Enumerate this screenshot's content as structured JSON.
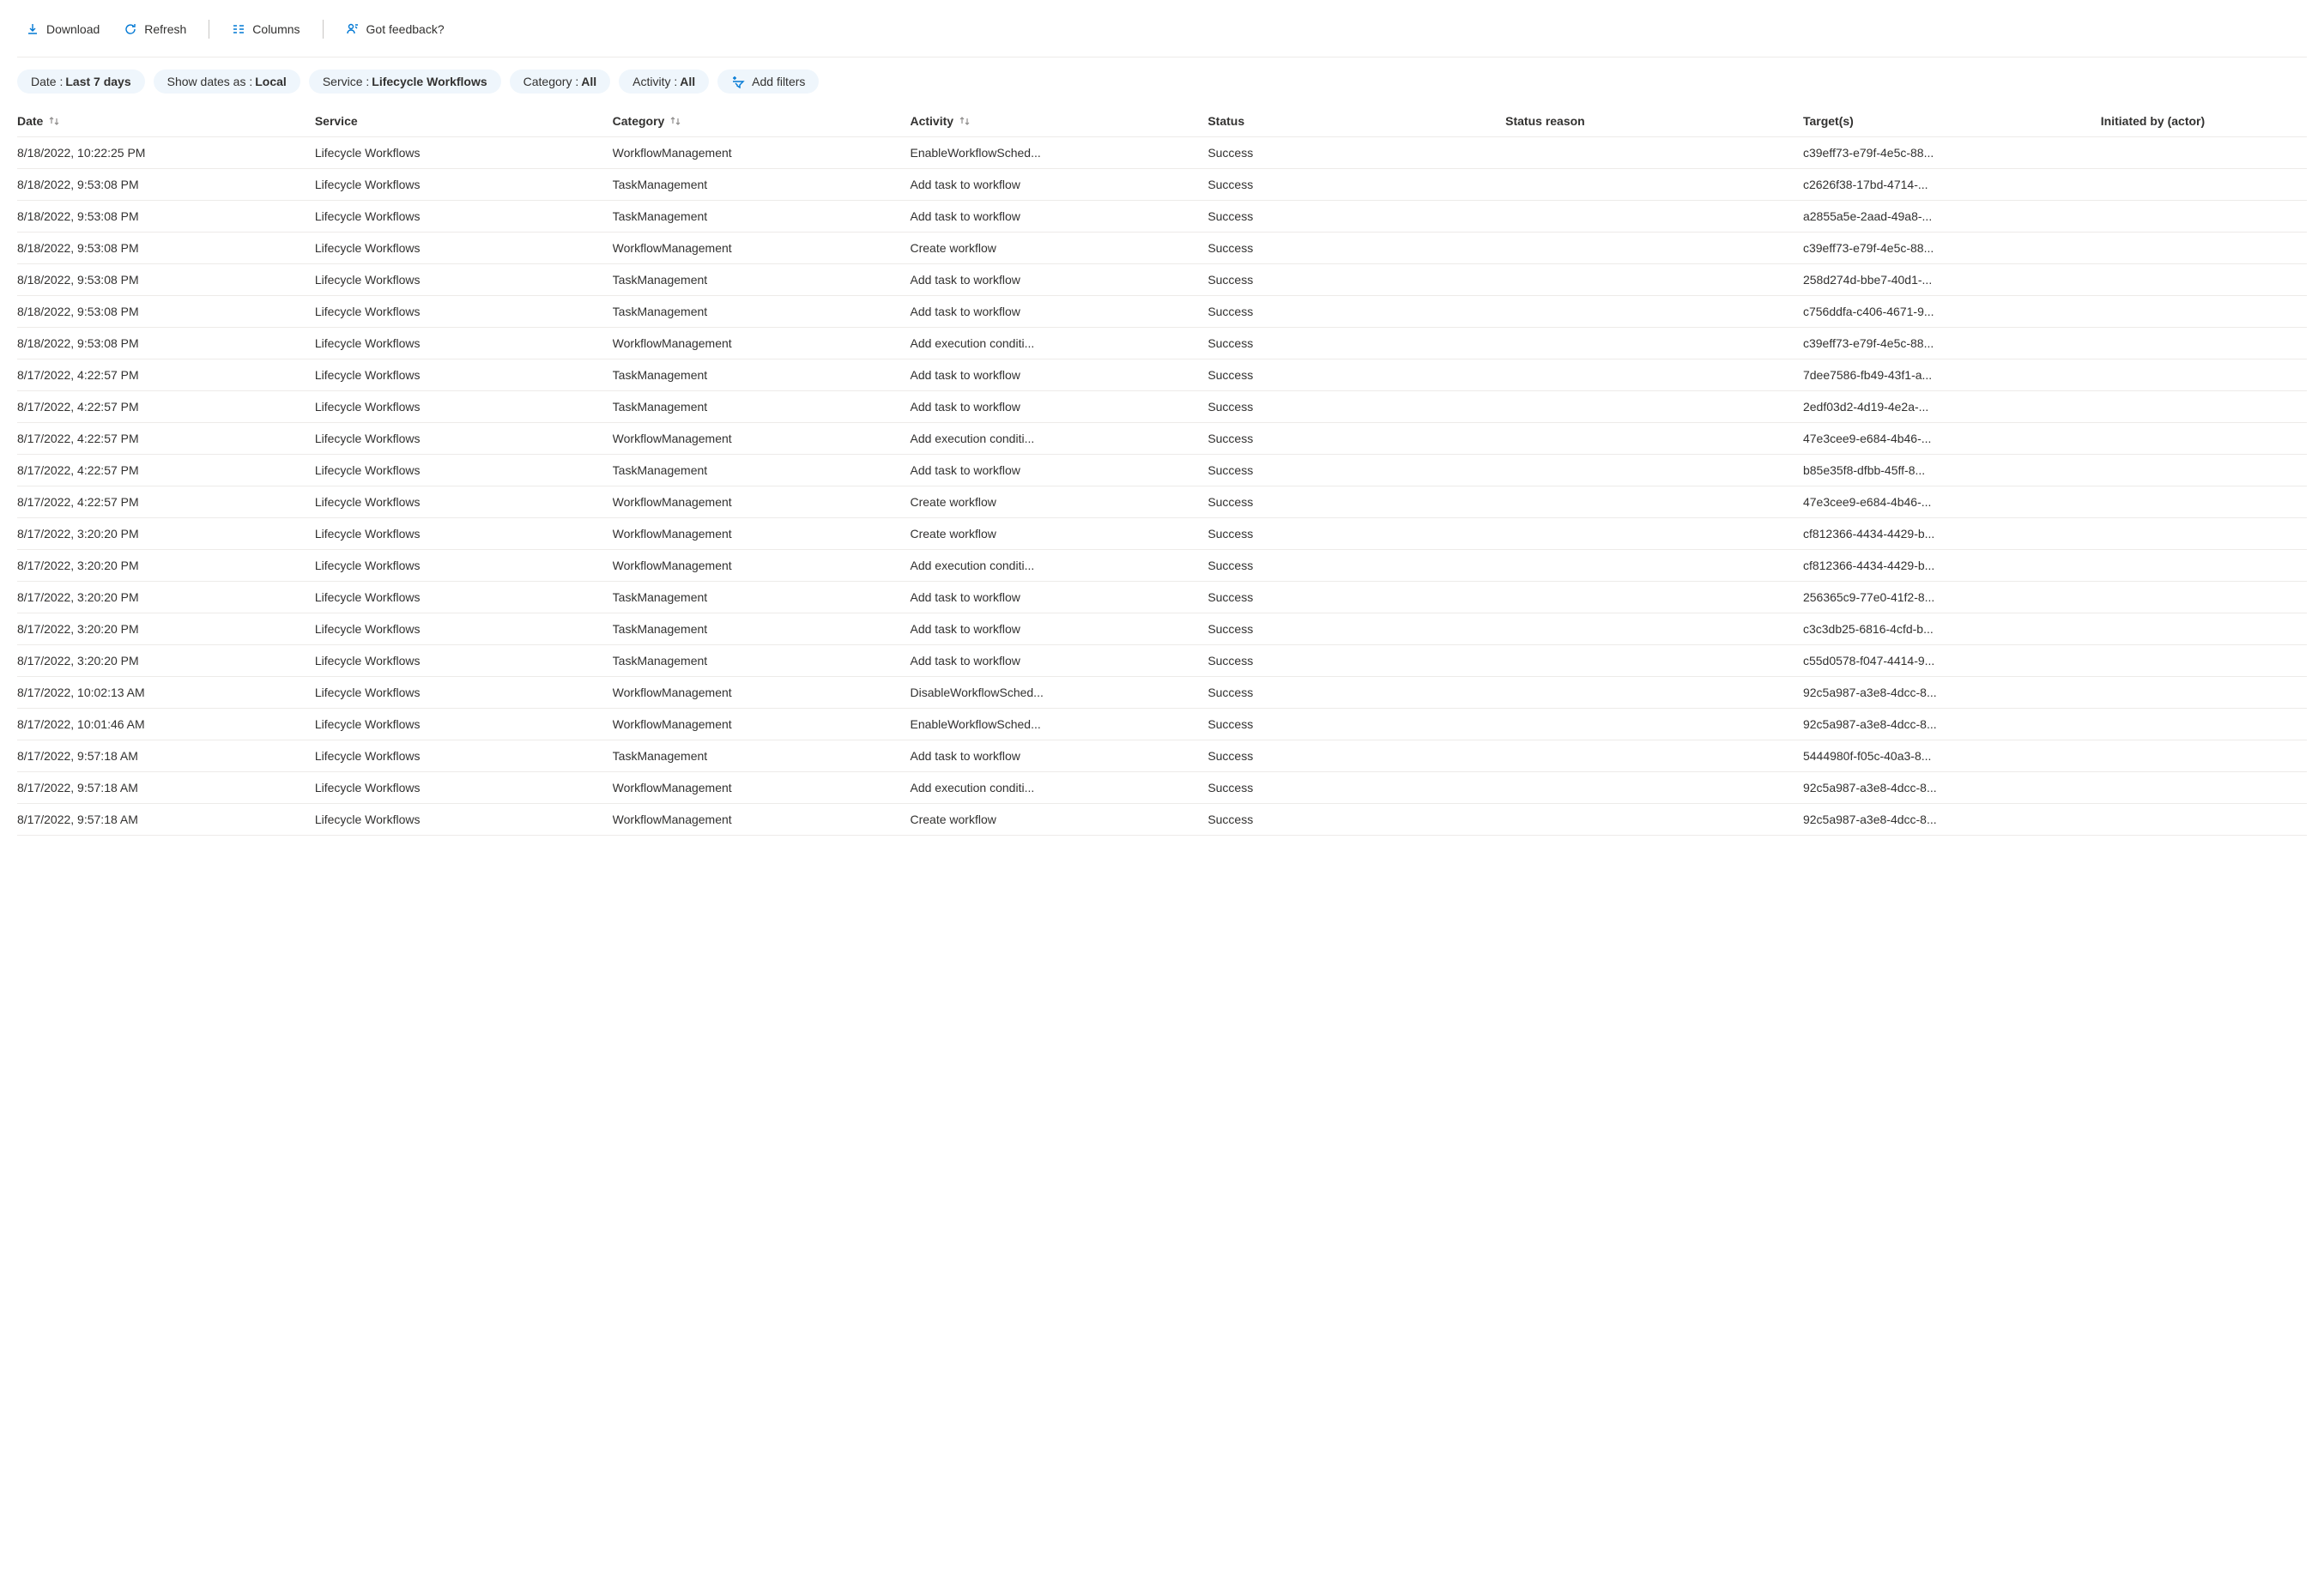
{
  "toolbar": {
    "download": "Download",
    "refresh": "Refresh",
    "columns": "Columns",
    "feedback": "Got feedback?"
  },
  "filters": {
    "date": {
      "label": "Date : ",
      "value": "Last 7 days"
    },
    "showDates": {
      "label": "Show dates as : ",
      "value": "Local"
    },
    "service": {
      "label": "Service : ",
      "value": "Lifecycle Workflows"
    },
    "category": {
      "label": "Category : ",
      "value": "All"
    },
    "activity": {
      "label": "Activity : ",
      "value": "All"
    },
    "addFilters": "Add filters"
  },
  "columns": {
    "date": "Date",
    "service": "Service",
    "category": "Category",
    "activity": "Activity",
    "status": "Status",
    "reason": "Status reason",
    "targets": "Target(s)",
    "actor": "Initiated by (actor)"
  },
  "rows": [
    {
      "date": "8/18/2022, 10:22:25 PM",
      "service": "Lifecycle Workflows",
      "category": "WorkflowManagement",
      "activity": "EnableWorkflowSched...",
      "status": "Success",
      "reason": "",
      "targets": "c39eff73-e79f-4e5c-88...",
      "actor": ""
    },
    {
      "date": "8/18/2022, 9:53:08 PM",
      "service": "Lifecycle Workflows",
      "category": "TaskManagement",
      "activity": "Add task to workflow",
      "status": "Success",
      "reason": "",
      "targets": "c2626f38-17bd-4714-...",
      "actor": ""
    },
    {
      "date": "8/18/2022, 9:53:08 PM",
      "service": "Lifecycle Workflows",
      "category": "TaskManagement",
      "activity": "Add task to workflow",
      "status": "Success",
      "reason": "",
      "targets": "a2855a5e-2aad-49a8-...",
      "actor": ""
    },
    {
      "date": "8/18/2022, 9:53:08 PM",
      "service": "Lifecycle Workflows",
      "category": "WorkflowManagement",
      "activity": "Create workflow",
      "status": "Success",
      "reason": "",
      "targets": "c39eff73-e79f-4e5c-88...",
      "actor": ""
    },
    {
      "date": "8/18/2022, 9:53:08 PM",
      "service": "Lifecycle Workflows",
      "category": "TaskManagement",
      "activity": "Add task to workflow",
      "status": "Success",
      "reason": "",
      "targets": "258d274d-bbe7-40d1-...",
      "actor": ""
    },
    {
      "date": "8/18/2022, 9:53:08 PM",
      "service": "Lifecycle Workflows",
      "category": "TaskManagement",
      "activity": "Add task to workflow",
      "status": "Success",
      "reason": "",
      "targets": "c756ddfa-c406-4671-9...",
      "actor": ""
    },
    {
      "date": "8/18/2022, 9:53:08 PM",
      "service": "Lifecycle Workflows",
      "category": "WorkflowManagement",
      "activity": "Add execution conditi...",
      "status": "Success",
      "reason": "",
      "targets": "c39eff73-e79f-4e5c-88...",
      "actor": ""
    },
    {
      "date": "8/17/2022, 4:22:57 PM",
      "service": "Lifecycle Workflows",
      "category": "TaskManagement",
      "activity": "Add task to workflow",
      "status": "Success",
      "reason": "",
      "targets": "7dee7586-fb49-43f1-a...",
      "actor": ""
    },
    {
      "date": "8/17/2022, 4:22:57 PM",
      "service": "Lifecycle Workflows",
      "category": "TaskManagement",
      "activity": "Add task to workflow",
      "status": "Success",
      "reason": "",
      "targets": "2edf03d2-4d19-4e2a-...",
      "actor": ""
    },
    {
      "date": "8/17/2022, 4:22:57 PM",
      "service": "Lifecycle Workflows",
      "category": "WorkflowManagement",
      "activity": "Add execution conditi...",
      "status": "Success",
      "reason": "",
      "targets": "47e3cee9-e684-4b46-...",
      "actor": ""
    },
    {
      "date": "8/17/2022, 4:22:57 PM",
      "service": "Lifecycle Workflows",
      "category": "TaskManagement",
      "activity": "Add task to workflow",
      "status": "Success",
      "reason": "",
      "targets": "b85e35f8-dfbb-45ff-8...",
      "actor": ""
    },
    {
      "date": "8/17/2022, 4:22:57 PM",
      "service": "Lifecycle Workflows",
      "category": "WorkflowManagement",
      "activity": "Create workflow",
      "status": "Success",
      "reason": "",
      "targets": "47e3cee9-e684-4b46-...",
      "actor": ""
    },
    {
      "date": "8/17/2022, 3:20:20 PM",
      "service": "Lifecycle Workflows",
      "category": "WorkflowManagement",
      "activity": "Create workflow",
      "status": "Success",
      "reason": "",
      "targets": "cf812366-4434-4429-b...",
      "actor": ""
    },
    {
      "date": "8/17/2022, 3:20:20 PM",
      "service": "Lifecycle Workflows",
      "category": "WorkflowManagement",
      "activity": "Add execution conditi...",
      "status": "Success",
      "reason": "",
      "targets": "cf812366-4434-4429-b...",
      "actor": ""
    },
    {
      "date": "8/17/2022, 3:20:20 PM",
      "service": "Lifecycle Workflows",
      "category": "TaskManagement",
      "activity": "Add task to workflow",
      "status": "Success",
      "reason": "",
      "targets": "256365c9-77e0-41f2-8...",
      "actor": ""
    },
    {
      "date": "8/17/2022, 3:20:20 PM",
      "service": "Lifecycle Workflows",
      "category": "TaskManagement",
      "activity": "Add task to workflow",
      "status": "Success",
      "reason": "",
      "targets": "c3c3db25-6816-4cfd-b...",
      "actor": ""
    },
    {
      "date": "8/17/2022, 3:20:20 PM",
      "service": "Lifecycle Workflows",
      "category": "TaskManagement",
      "activity": "Add task to workflow",
      "status": "Success",
      "reason": "",
      "targets": "c55d0578-f047-4414-9...",
      "actor": ""
    },
    {
      "date": "8/17/2022, 10:02:13 AM",
      "service": "Lifecycle Workflows",
      "category": "WorkflowManagement",
      "activity": "DisableWorkflowSched...",
      "status": "Success",
      "reason": "",
      "targets": "92c5a987-a3e8-4dcc-8...",
      "actor": ""
    },
    {
      "date": "8/17/2022, 10:01:46 AM",
      "service": "Lifecycle Workflows",
      "category": "WorkflowManagement",
      "activity": "EnableWorkflowSched...",
      "status": "Success",
      "reason": "",
      "targets": "92c5a987-a3e8-4dcc-8...",
      "actor": ""
    },
    {
      "date": "8/17/2022, 9:57:18 AM",
      "service": "Lifecycle Workflows",
      "category": "TaskManagement",
      "activity": "Add task to workflow",
      "status": "Success",
      "reason": "",
      "targets": "5444980f-f05c-40a3-8...",
      "actor": ""
    },
    {
      "date": "8/17/2022, 9:57:18 AM",
      "service": "Lifecycle Workflows",
      "category": "WorkflowManagement",
      "activity": "Add execution conditi...",
      "status": "Success",
      "reason": "",
      "targets": "92c5a987-a3e8-4dcc-8...",
      "actor": ""
    },
    {
      "date": "8/17/2022, 9:57:18 AM",
      "service": "Lifecycle Workflows",
      "category": "WorkflowManagement",
      "activity": "Create workflow",
      "status": "Success",
      "reason": "",
      "targets": "92c5a987-a3e8-4dcc-8...",
      "actor": ""
    }
  ]
}
